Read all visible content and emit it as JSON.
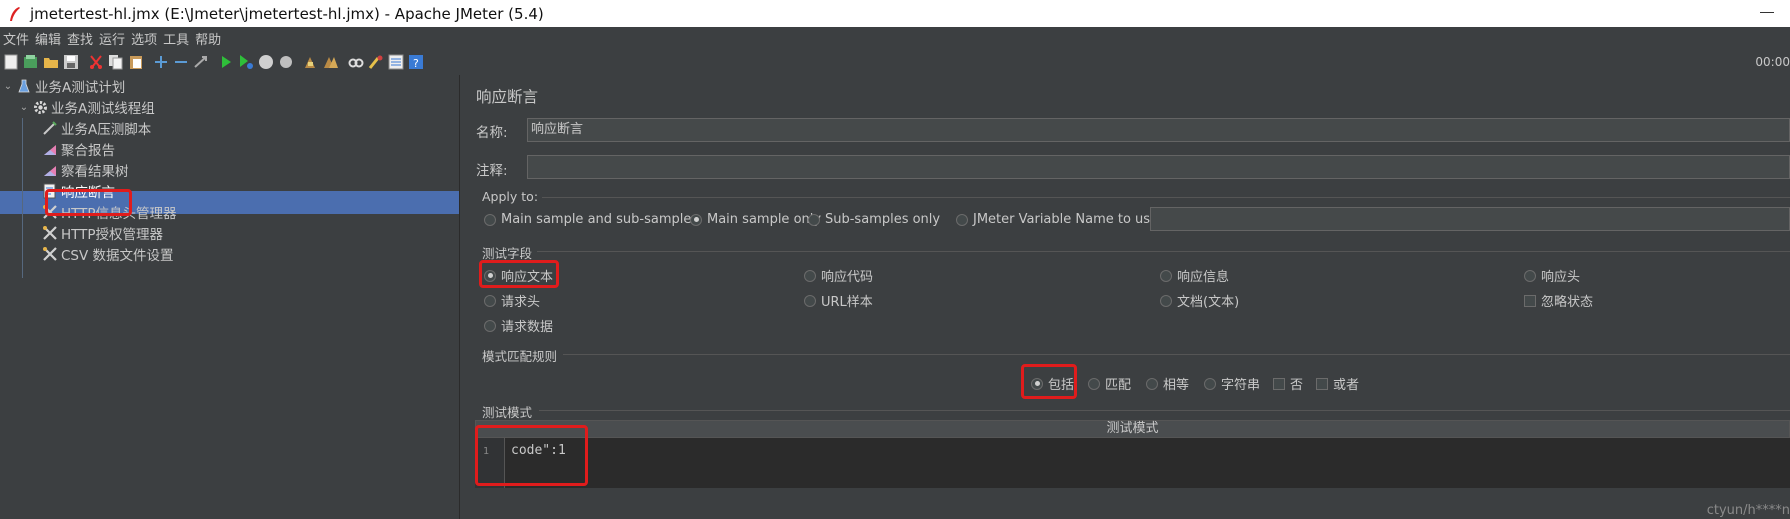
{
  "window": {
    "title": "jmetertest-hl.jmx (E:\\Jmeter\\jmetertest-hl.jmx) - Apache JMeter (5.4)"
  },
  "menu": [
    "文件",
    "编辑",
    "查找",
    "运行",
    "选项",
    "工具",
    "帮助"
  ],
  "toolbar": {
    "timer": "00:00"
  },
  "tree": {
    "plan": "业务A测试计划",
    "thread_group": "业务A测试线程组",
    "items": [
      "业务A压测脚本",
      "聚合报告",
      "察看结果树",
      "响应断言",
      "HTTP信息头管理器",
      "HTTP授权管理器",
      "CSV 数据文件设置"
    ],
    "selected_index": 3
  },
  "panel": {
    "title": "响应断言",
    "name_label": "名称:",
    "name_value": "响应断言",
    "comment_label": "注释:",
    "comment_value": "",
    "apply_to": {
      "label": "Apply to:",
      "options": [
        "Main sample and sub-samples",
        "Main sample only",
        "Sub-samples only",
        "JMeter Variable Name to use"
      ],
      "selected": "Main sample only",
      "variable_value": ""
    },
    "test_field": {
      "label": "测试字段",
      "options": [
        "响应文本",
        "响应代码",
        "响应信息",
        "响应头",
        "请求头",
        "URL样本",
        "文档(文本)",
        "请求数据"
      ],
      "ignore_status": "忽略状态",
      "selected": "响应文本"
    },
    "pattern_rules": {
      "label": "模式匹配规则",
      "radios": [
        "包括",
        "匹配",
        "相等",
        "字符串"
      ],
      "checkboxes": [
        "否",
        "或者"
      ],
      "selected": "包括"
    },
    "test_patterns": {
      "label": "测试模式",
      "column_header": "测试模式",
      "line_number": "1",
      "code": "code\":1"
    }
  },
  "watermark": "ctyun/h****n"
}
